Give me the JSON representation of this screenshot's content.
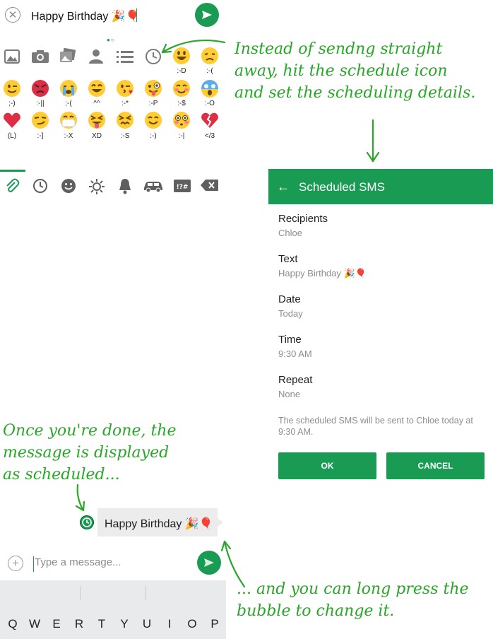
{
  "compose": {
    "message_text": "Happy Birthday 🎉🎈"
  },
  "emoji_panel": {
    "rows": [
      [
        {
          "label": ":-D"
        },
        {
          "label": ":-("
        }
      ],
      [
        {
          "label": ";-)"
        },
        {
          "label": ":-||"
        },
        {
          "label": ";-("
        },
        {
          "label": "^^"
        },
        {
          "label": ":-*"
        },
        {
          "label": ":-P"
        },
        {
          "label": ":-$"
        },
        {
          "label": ":-O"
        }
      ],
      [
        {
          "label": "(L)"
        },
        {
          "label": ":-]"
        },
        {
          "label": ":-X"
        },
        {
          "label": "XD"
        },
        {
          "label": ":-S"
        },
        {
          "label": ":-)"
        },
        {
          "label": ":-|"
        },
        {
          "label": "</3"
        }
      ]
    ]
  },
  "scheduled_sms": {
    "title": "Scheduled SMS",
    "recipients_label": "Recipients",
    "recipients_value": "Chloe",
    "text_label": "Text",
    "text_value": "Happy Birthday 🎉🎈",
    "date_label": "Date",
    "date_value": "Today",
    "time_label": "Time",
    "time_value": "9:30 AM",
    "repeat_label": "Repeat",
    "repeat_value": "None",
    "note": "The scheduled SMS will be sent to Chloe today at 9:30 AM.",
    "ok_label": "OK",
    "cancel_label": "CANCEL"
  },
  "bubble": {
    "text": "Happy Birthday 🎉🎈"
  },
  "input_bar": {
    "placeholder": "Type a message..."
  },
  "keyboard": {
    "keys": [
      "Q",
      "W",
      "E",
      "R",
      "T",
      "Y",
      "U",
      "I",
      "O",
      "P"
    ]
  },
  "annotations": {
    "a1_l1": "Instead of sendng straight",
    "a1_l2": "away, hit the schedule icon",
    "a1_l3": "and set the scheduling details.",
    "a2_l1": "Once you're done, the",
    "a2_l2": "message is displayed",
    "a2_l3": "as scheduled...",
    "a3_l1": "... and you can long press the",
    "a3_l2": "bubble to change it."
  },
  "colors": {
    "accent": "#1a9b54",
    "annotation": "#2aa62a"
  }
}
